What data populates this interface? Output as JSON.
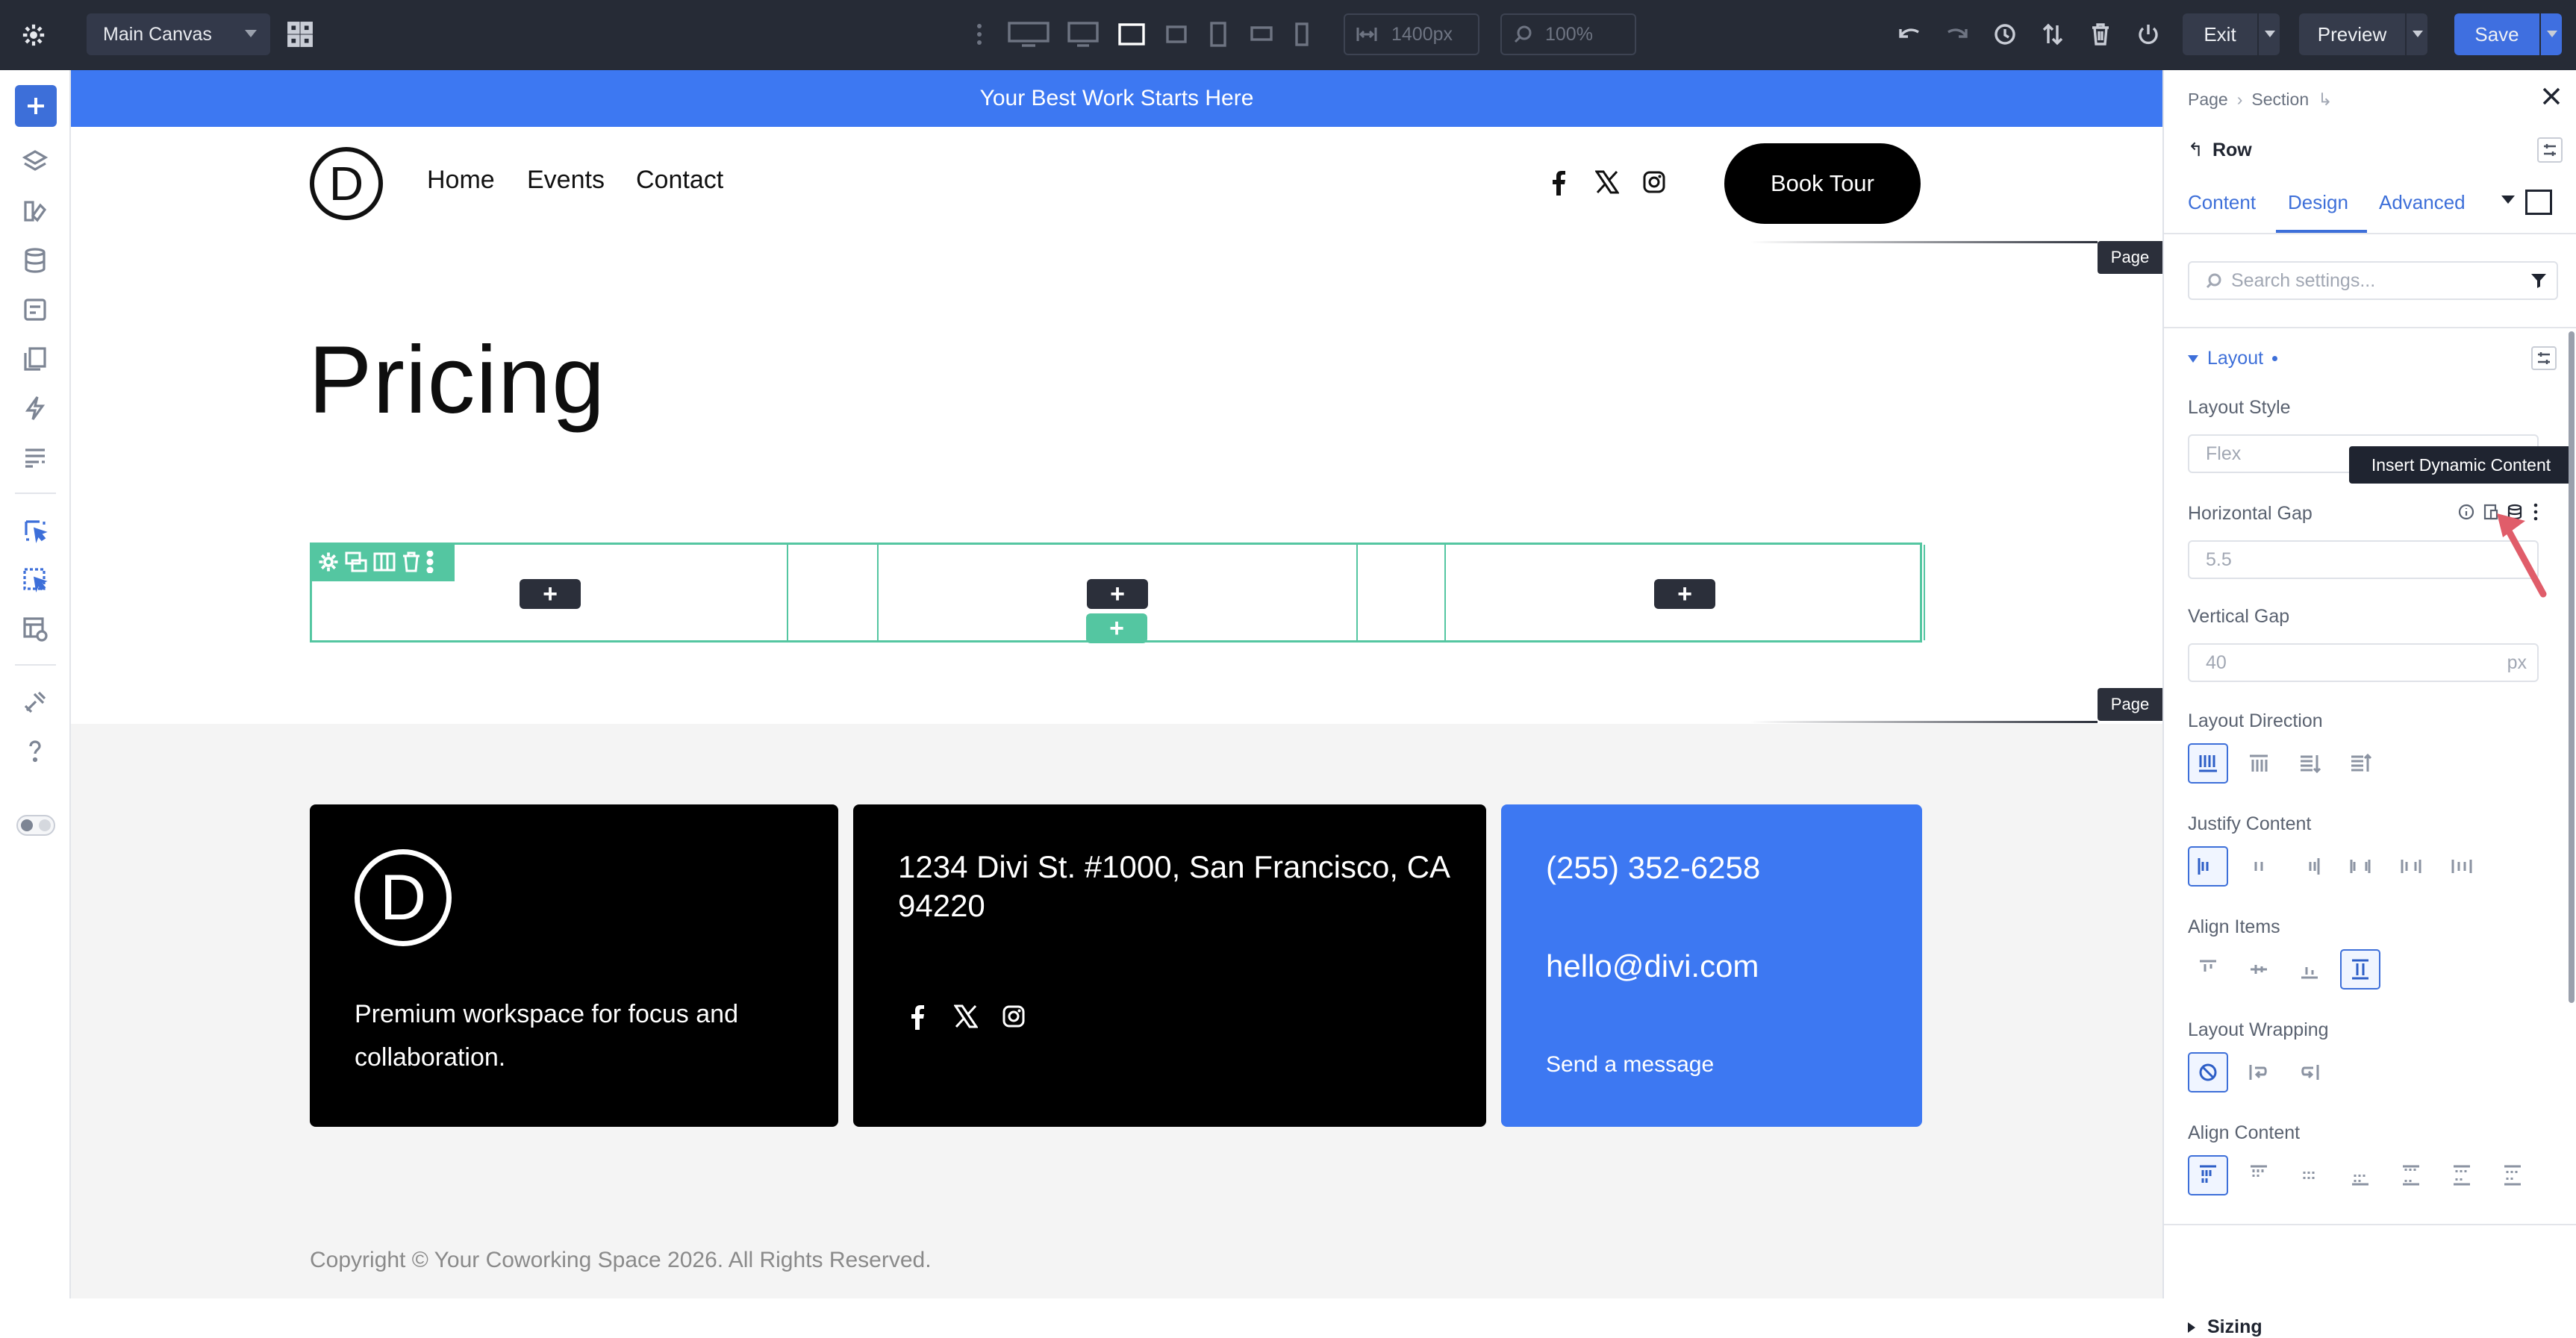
{
  "toolbar": {
    "canvas_name": "Main Canvas",
    "width_value": "1400px",
    "zoom_value": "100%",
    "exit_label": "Exit",
    "preview_label": "Preview",
    "save_label": "Save"
  },
  "page": {
    "banner_text": "Your Best Work Starts Here",
    "logo_letter": "D",
    "nav": [
      "Home",
      "Events",
      "Contact"
    ],
    "cta_label": "Book Tour",
    "page_tag": "Page",
    "heading": "Pricing",
    "add_symbol": "+"
  },
  "footer": {
    "tagline": "Premium workspace for focus and collaboration.",
    "address": "1234 Divi St. #1000, San Francisco, CA 94220",
    "phone": "(255) 352-6258",
    "email": "hello@divi.com",
    "message_link": "Send a message",
    "copyright": "Copyright © Your Coworking Space 2026. All Rights Reserved."
  },
  "panel": {
    "breadcrumb": [
      "Page",
      "Section"
    ],
    "element": "Row",
    "tabs": [
      "Content",
      "Design",
      "Advanced"
    ],
    "active_tab": "Design",
    "search_placeholder": "Search settings...",
    "group_layout": "Layout",
    "layout_style_label": "Layout Style",
    "layout_style_value": "Flex",
    "tooltip": "Insert Dynamic Content",
    "h_gap_label": "Horizontal Gap",
    "h_gap_value": "5.5",
    "v_gap_label": "Vertical Gap",
    "v_gap_value": "40",
    "v_gap_unit": "px",
    "direction_label": "Layout Direction",
    "justify_label": "Justify Content",
    "align_items_label": "Align Items",
    "wrapping_label": "Layout Wrapping",
    "align_content_label": "Align Content",
    "group_sizing": "Sizing"
  },
  "colors": {
    "accent": "#3d78f2",
    "row_outline": "#54c6a1",
    "toolbar_bg": "#262b36",
    "arrow": "#e05d6a"
  }
}
